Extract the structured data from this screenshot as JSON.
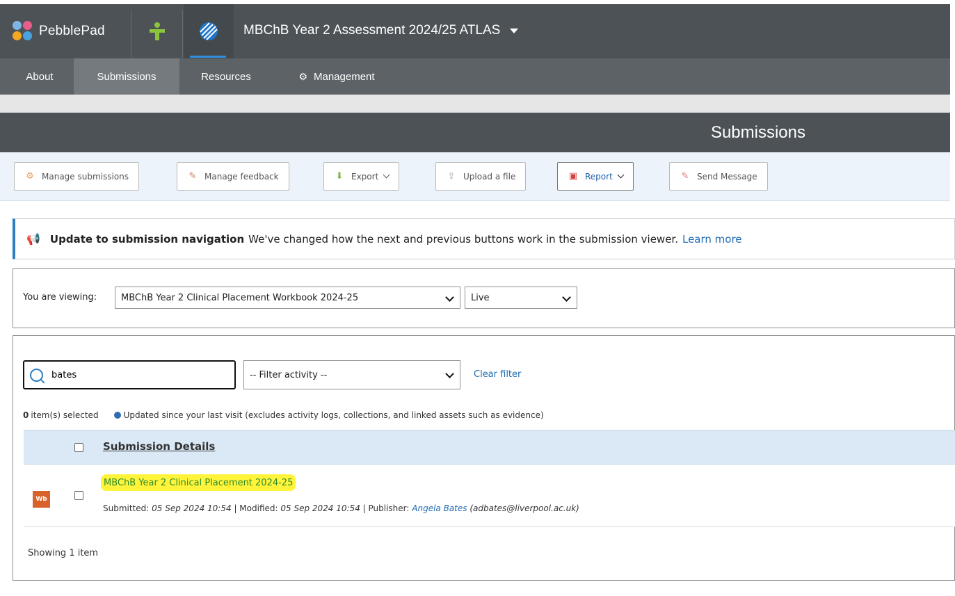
{
  "app": {
    "brand_name": "PebblePad",
    "workspace_title": "MBChB Year 2 Assessment 2024/25 ATLAS",
    "colors": {
      "accent": "#2d7fc1",
      "topbar": "#4d5257",
      "highlight": "#fff43a"
    }
  },
  "nav": {
    "items": [
      {
        "label": "About"
      },
      {
        "label": "Submissions"
      },
      {
        "label": "Resources"
      },
      {
        "label": "Management",
        "icon": "gear-icon"
      }
    ],
    "active": "Submissions"
  },
  "page": {
    "title": "Submissions"
  },
  "toolbar": {
    "manage_submissions": "Manage submissions",
    "manage_feedback": "Manage feedback",
    "export": "Export",
    "upload": "Upload a file",
    "report": "Report",
    "send_message": "Send Message"
  },
  "notice": {
    "title": "Update to submission navigation",
    "text": "We've changed how the next and previous buttons work in the submission viewer.",
    "link": "Learn more"
  },
  "viewing": {
    "label": "You are viewing:",
    "workbook": "MBChB Year 2 Clinical Placement Workbook 2024-25",
    "status": "Live"
  },
  "filters": {
    "search_value": "bates",
    "activity_placeholder": "-- Filter activity --",
    "clear": "Clear filter"
  },
  "selection": {
    "count": "0",
    "count_suffix": "item(s) selected",
    "legend": "Updated since your last visit (excludes activity logs, collections, and linked assets such as evidence)"
  },
  "table": {
    "header": "Submission Details",
    "rows": [
      {
        "type_badge": "Wb",
        "title": "MBChB Year 2 Clinical Placement 2024-25",
        "submitted_label": "Submitted:",
        "submitted": "05 Sep 2024 10:54",
        "modified_label": "Modified:",
        "modified": "05 Sep 2024 10:54",
        "publisher_label": "Publisher:",
        "publisher_name": "Angela Bates",
        "publisher_email": "(adbates@liverpool.ac.uk)"
      }
    ]
  },
  "footer": {
    "showing": "Showing 1 item"
  }
}
